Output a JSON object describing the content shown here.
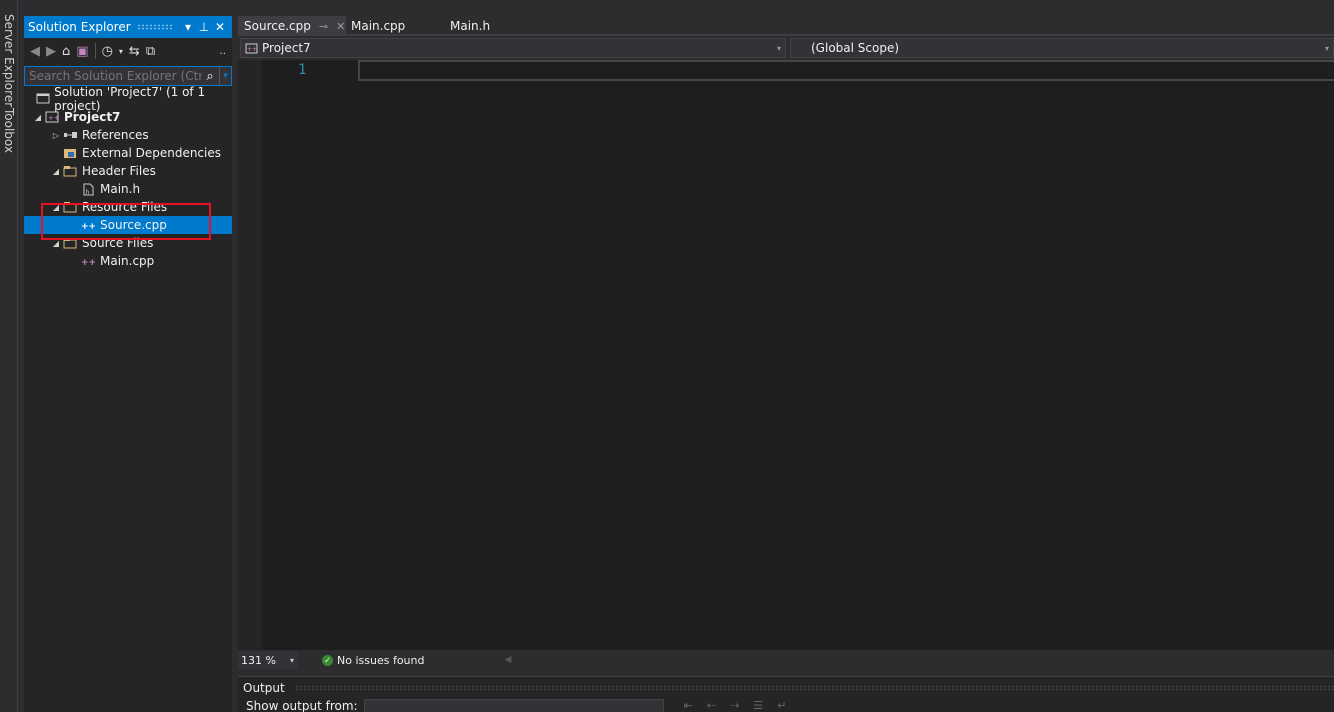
{
  "side_tabs": {
    "server_explorer": "Server Explorer",
    "toolbox": "Toolbox"
  },
  "solution_explorer": {
    "title": "Solution Explorer",
    "search_placeholder": "Search Solution Explorer (Ctrl+;)",
    "tree": [
      {
        "label": "Solution 'Project7' (1 of 1 project)",
        "icon": "solution-icon",
        "expanded": null
      },
      {
        "label": "Project7",
        "icon": "cpp-project-icon",
        "expanded": true,
        "bold": true
      },
      {
        "label": "References",
        "icon": "references-icon",
        "expanded": false
      },
      {
        "label": "External Dependencies",
        "icon": "external-dependencies-icon",
        "expanded": null
      },
      {
        "label": "Header Files",
        "icon": "folder-filter-icon",
        "expanded": true
      },
      {
        "label": "Main.h",
        "icon": "header-file-icon",
        "expanded": null
      },
      {
        "label": "Resource Files",
        "icon": "folder-filter-icon",
        "expanded": true
      },
      {
        "label": "Source.cpp",
        "icon": "cpp-file-icon",
        "expanded": null,
        "selected": true
      },
      {
        "label": "Source Files",
        "icon": "folder-filter-icon",
        "expanded": true
      },
      {
        "label": "Main.cpp",
        "icon": "cpp-file-icon",
        "expanded": null
      }
    ]
  },
  "editor": {
    "tabs": [
      {
        "label": "Source.cpp",
        "active": true
      },
      {
        "label": "Main.cpp",
        "active": false
      },
      {
        "label": "Main.h",
        "active": false
      }
    ],
    "nav": {
      "project": "Project7",
      "scope": "(Global Scope)"
    },
    "line_number": "1"
  },
  "status": {
    "zoom": "131 %",
    "issues": "No issues found"
  },
  "output": {
    "title": "Output",
    "show_from_label": "Show output from:"
  },
  "colors": {
    "accent": "#007acc",
    "highlight_box": "#e81123",
    "editor_bg": "#1e1e1e"
  }
}
